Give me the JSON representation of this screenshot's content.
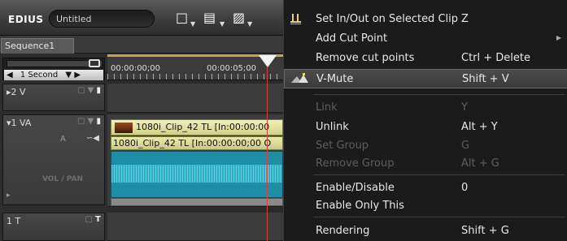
{
  "app": {
    "brand": "EDIUS",
    "project_name": "Untitled",
    "sequence_tab": "Sequence1"
  },
  "timeline": {
    "scale_label": "1 Second",
    "ruler_timecodes": [
      "00:00:00;00",
      "00:00:05;00"
    ],
    "tracks": [
      {
        "label": "2 V",
        "type": "video"
      },
      {
        "label": "1 VA",
        "type": "video-audio"
      },
      {
        "label": "1 T",
        "type": "title"
      }
    ],
    "vol_pan_label": "VOL / PAN",
    "clip_video_label": "1080i_Clip_42  TL [In:00:00:00",
    "clip_audio_label": "1080i_Clip_42  TL [In:00:00:00;00 O"
  },
  "context_menu": {
    "items": [
      {
        "label": "Set In/Out on Selected Clip",
        "shortcut": "Z",
        "enabled": true,
        "icon": "set-inout-icon"
      },
      {
        "label": "Add Cut Point",
        "shortcut": "",
        "enabled": true,
        "submenu": true
      },
      {
        "label": "Remove cut points",
        "shortcut": "Ctrl + Delete",
        "enabled": true
      },
      {
        "label": "V-Mute",
        "shortcut": "Shift + V",
        "enabled": true,
        "highlighted": true,
        "icon": "v-mute-icon"
      },
      {
        "label": "Link",
        "shortcut": "Y",
        "enabled": false
      },
      {
        "label": "Unlink",
        "shortcut": "Alt + Y",
        "enabled": true
      },
      {
        "label": "Set Group",
        "shortcut": "G",
        "enabled": false
      },
      {
        "label": "Remove Group",
        "shortcut": "Alt + G",
        "enabled": false
      },
      {
        "label": "Enable/Disable",
        "shortcut": "0",
        "enabled": true
      },
      {
        "label": "Enable Only This",
        "shortcut": "",
        "enabled": true
      },
      {
        "label": "Rendering",
        "shortcut": "Shift + G",
        "enabled": true
      }
    ]
  },
  "colors": {
    "clip_video": "#e3e3a6",
    "waveform": "#1d8ea5",
    "playhead": "#d54040",
    "menu_bg": "#1b1b1b"
  }
}
